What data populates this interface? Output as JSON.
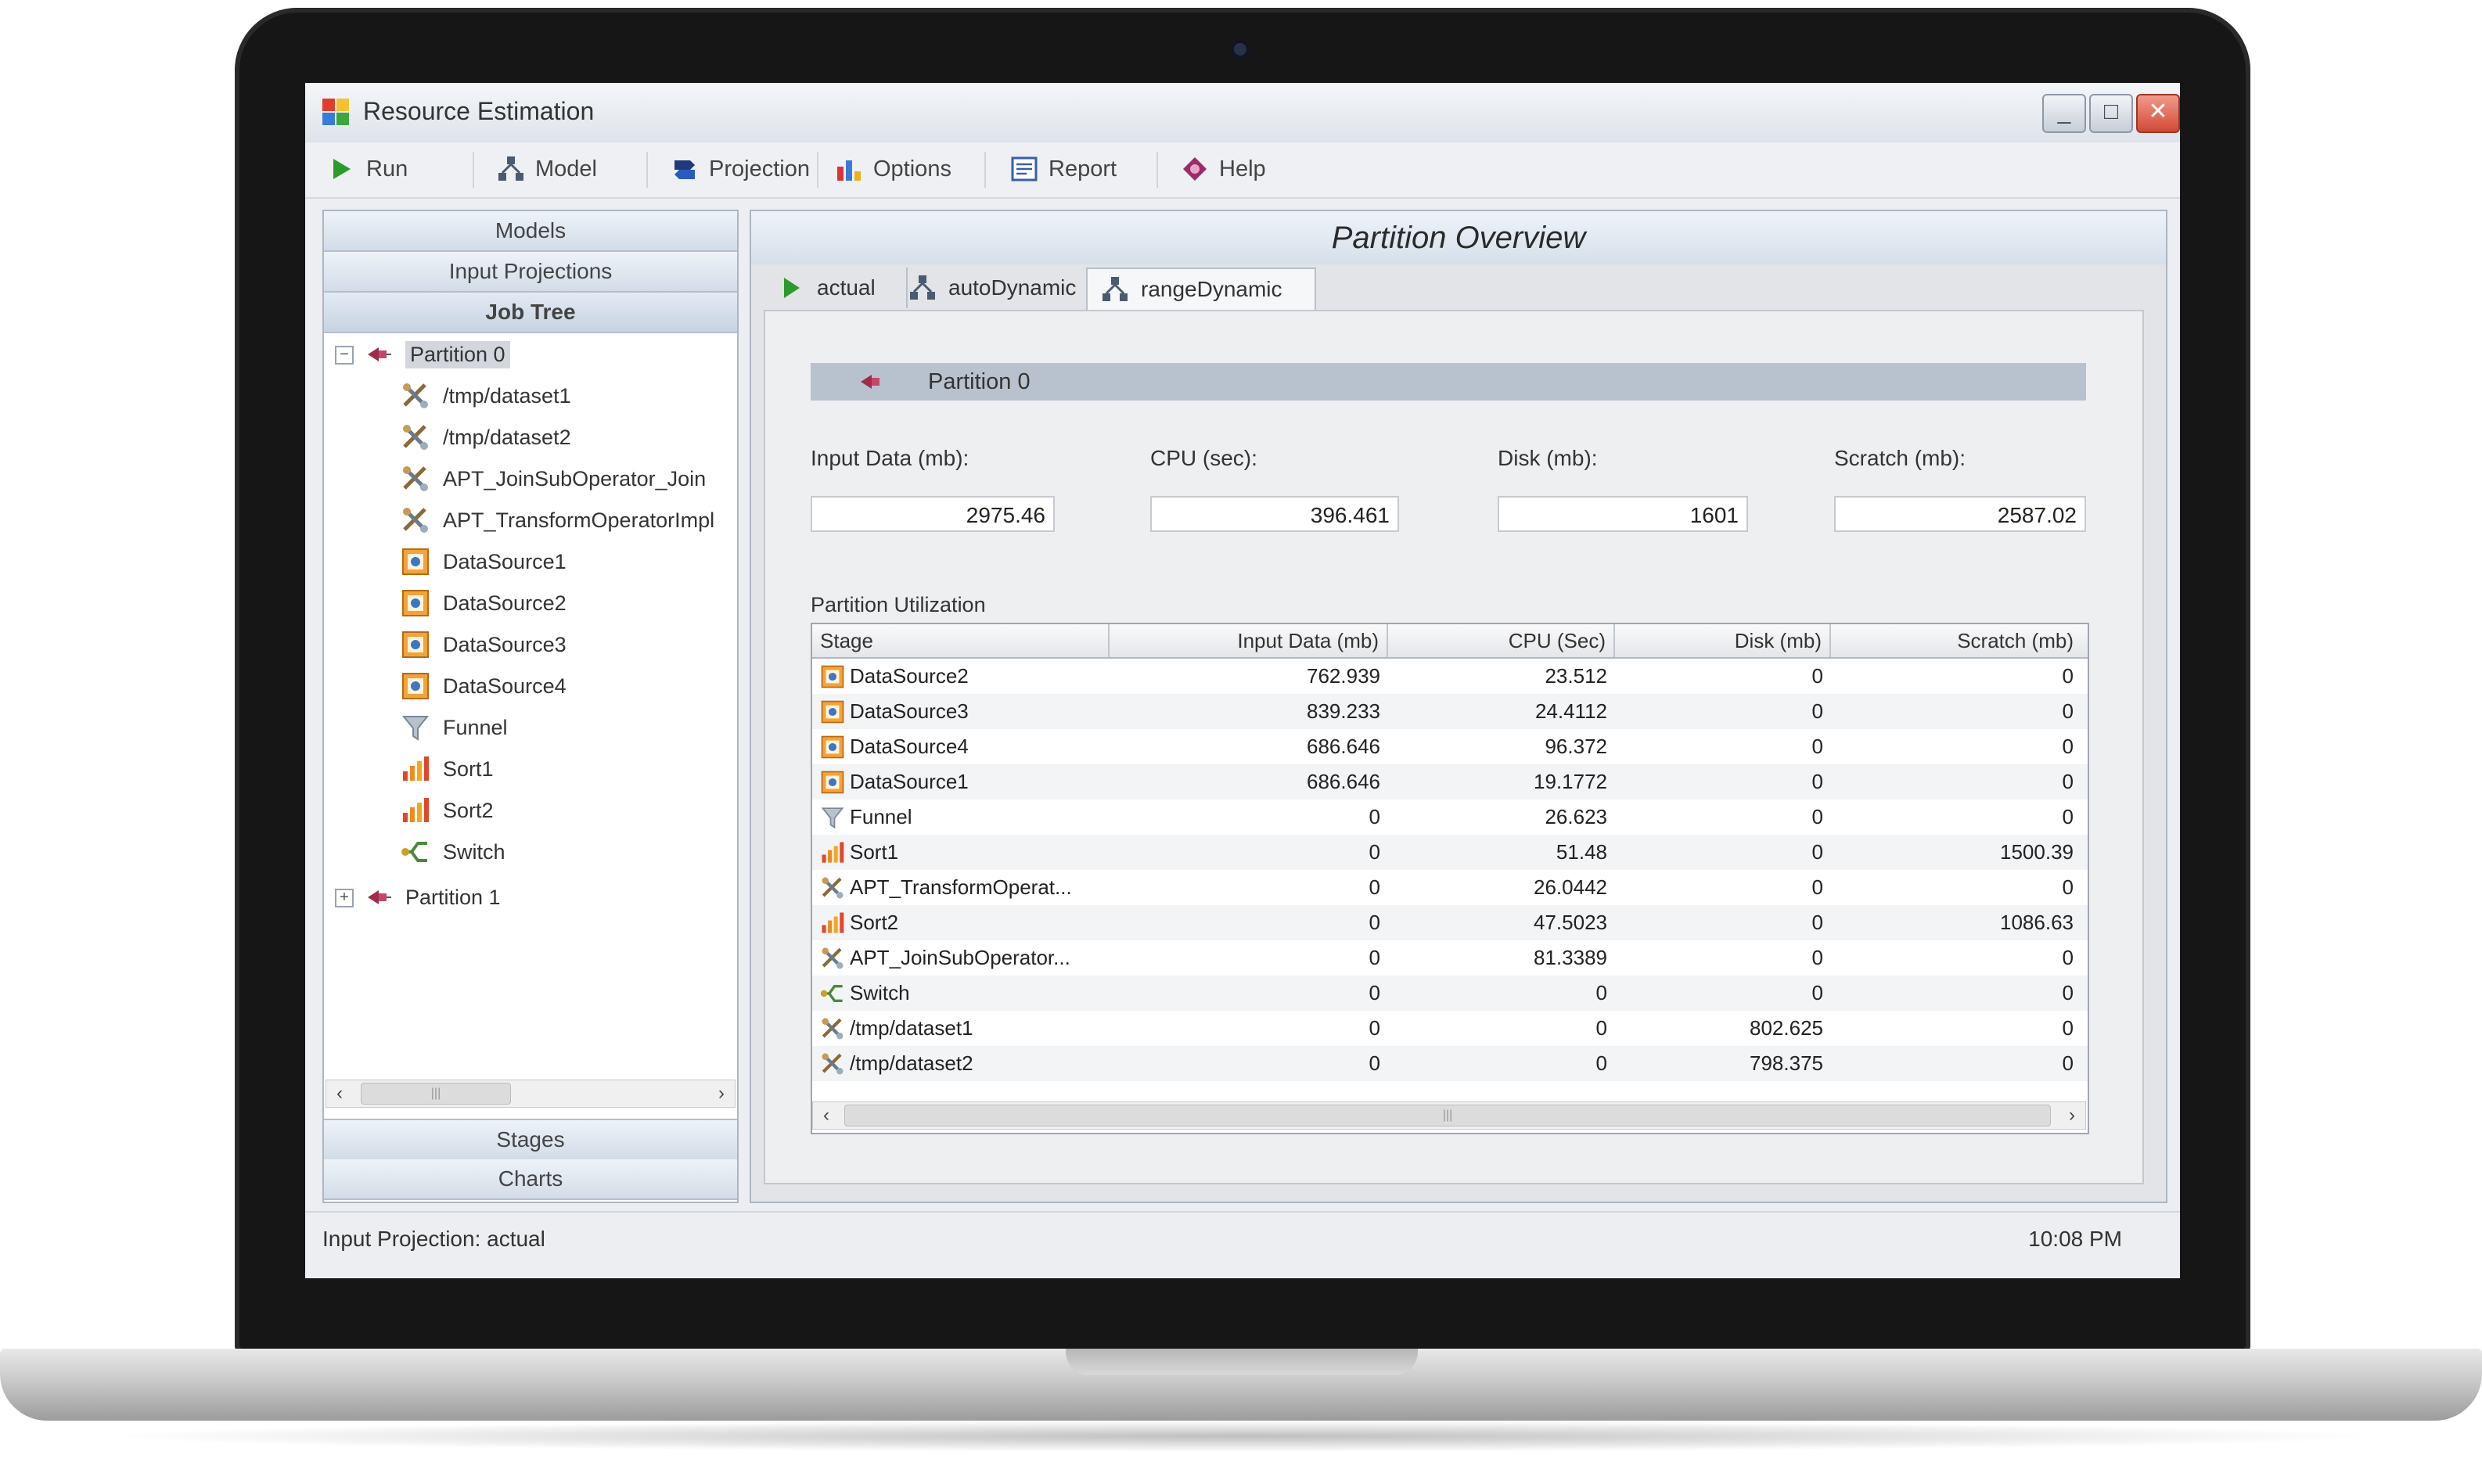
{
  "window": {
    "title": "Resource Estimation",
    "controls": {
      "minimize": "_",
      "maximize": "□",
      "close": "✕"
    }
  },
  "toolbar": [
    {
      "label": "Run",
      "icon": "run-icon"
    },
    {
      "label": "Model",
      "icon": "model-icon"
    },
    {
      "label": "Projection",
      "icon": "projection-icon"
    },
    {
      "label": "Options",
      "icon": "options-icon"
    },
    {
      "label": "Report",
      "icon": "report-icon"
    },
    {
      "label": "Help",
      "icon": "help-icon"
    }
  ],
  "left_panel": {
    "headers": {
      "models": "Models",
      "input_projections": "Input Projections",
      "job_tree": "Job Tree"
    },
    "tree": {
      "partition0": "Partition 0",
      "items": [
        {
          "label": "/tmp/dataset1",
          "icon": "operator-icon"
        },
        {
          "label": "/tmp/dataset2",
          "icon": "operator-icon"
        },
        {
          "label": "APT_JoinSubOperator_Join",
          "icon": "operator-icon"
        },
        {
          "label": "APT_TransformOperatorImpl",
          "icon": "operator-icon"
        },
        {
          "label": "DataSource1",
          "icon": "datasource-icon"
        },
        {
          "label": "DataSource2",
          "icon": "datasource-icon"
        },
        {
          "label": "DataSource3",
          "icon": "datasource-icon"
        },
        {
          "label": "DataSource4",
          "icon": "datasource-icon"
        },
        {
          "label": "Funnel",
          "icon": "funnel-icon"
        },
        {
          "label": "Sort1",
          "icon": "sort-icon"
        },
        {
          "label": "Sort2",
          "icon": "sort-icon"
        },
        {
          "label": "Switch",
          "icon": "switch-icon"
        }
      ],
      "partition1": "Partition 1",
      "expanded_glyph": "−",
      "collapsed_glyph": "+"
    },
    "footers": {
      "stages": "Stages",
      "charts": "Charts"
    },
    "scroll": {
      "left": "‹",
      "right": "›",
      "grip": "|||"
    }
  },
  "main": {
    "title": "Partition Overview",
    "tabs": [
      {
        "label": "actual",
        "icon": "run-icon"
      },
      {
        "label": "autoDynamic",
        "icon": "model-icon"
      },
      {
        "label": "rangeDynamic",
        "icon": "model-icon"
      }
    ],
    "partition_banner": "Partition 0",
    "metrics": {
      "input_data_label": "Input Data (mb):",
      "input_data_value": "2975.46",
      "cpu_label": "CPU (sec):",
      "cpu_value": "396.461",
      "disk_label": "Disk (mb):",
      "disk_value": "1601",
      "scratch_label": "Scratch (mb):",
      "scratch_value": "2587.02"
    },
    "utilization_label": "Partition Utilization",
    "grid": {
      "columns": [
        "Stage",
        "Input Data (mb)",
        "CPU (Sec)",
        "Disk (mb)",
        "Scratch (mb)"
      ],
      "rows": [
        {
          "stage": "DataSource2",
          "icon": "datasource-icon",
          "input": "762.939",
          "cpu": "23.512",
          "disk": "0",
          "scratch": "0"
        },
        {
          "stage": "DataSource3",
          "icon": "datasource-icon",
          "input": "839.233",
          "cpu": "24.4112",
          "disk": "0",
          "scratch": "0"
        },
        {
          "stage": "DataSource4",
          "icon": "datasource-icon",
          "input": "686.646",
          "cpu": "96.372",
          "disk": "0",
          "scratch": "0"
        },
        {
          "stage": "DataSource1",
          "icon": "datasource-icon",
          "input": "686.646",
          "cpu": "19.1772",
          "disk": "0",
          "scratch": "0"
        },
        {
          "stage": "Funnel",
          "icon": "funnel-icon",
          "input": "0",
          "cpu": "26.623",
          "disk": "0",
          "scratch": "0"
        },
        {
          "stage": "Sort1",
          "icon": "sort-icon",
          "input": "0",
          "cpu": "51.48",
          "disk": "0",
          "scratch": "1500.39"
        },
        {
          "stage": "APT_TransformOperat...",
          "icon": "operator-icon",
          "input": "0",
          "cpu": "26.0442",
          "disk": "0",
          "scratch": "0"
        },
        {
          "stage": "Sort2",
          "icon": "sort-icon",
          "input": "0",
          "cpu": "47.5023",
          "disk": "0",
          "scratch": "1086.63"
        },
        {
          "stage": "APT_JoinSubOperator...",
          "icon": "operator-icon",
          "input": "0",
          "cpu": "81.3389",
          "disk": "0",
          "scratch": "0"
        },
        {
          "stage": "Switch",
          "icon": "switch-icon",
          "input": "0",
          "cpu": "0",
          "disk": "0",
          "scratch": "0"
        },
        {
          "stage": "/tmp/dataset1",
          "icon": "operator-icon",
          "input": "0",
          "cpu": "0",
          "disk": "802.625",
          "scratch": "0"
        },
        {
          "stage": "/tmp/dataset2",
          "icon": "operator-icon",
          "input": "0",
          "cpu": "0",
          "disk": "798.375",
          "scratch": "0"
        }
      ]
    }
  },
  "status": {
    "left": "Input Projection: actual",
    "right": "10:08 PM"
  },
  "colors": {
    "accent": "#b8c2cf",
    "header_blue": "#d6dfea",
    "bezel": "#161616",
    "run_green": "#2c9a2c",
    "close_red": "#d24a36"
  }
}
